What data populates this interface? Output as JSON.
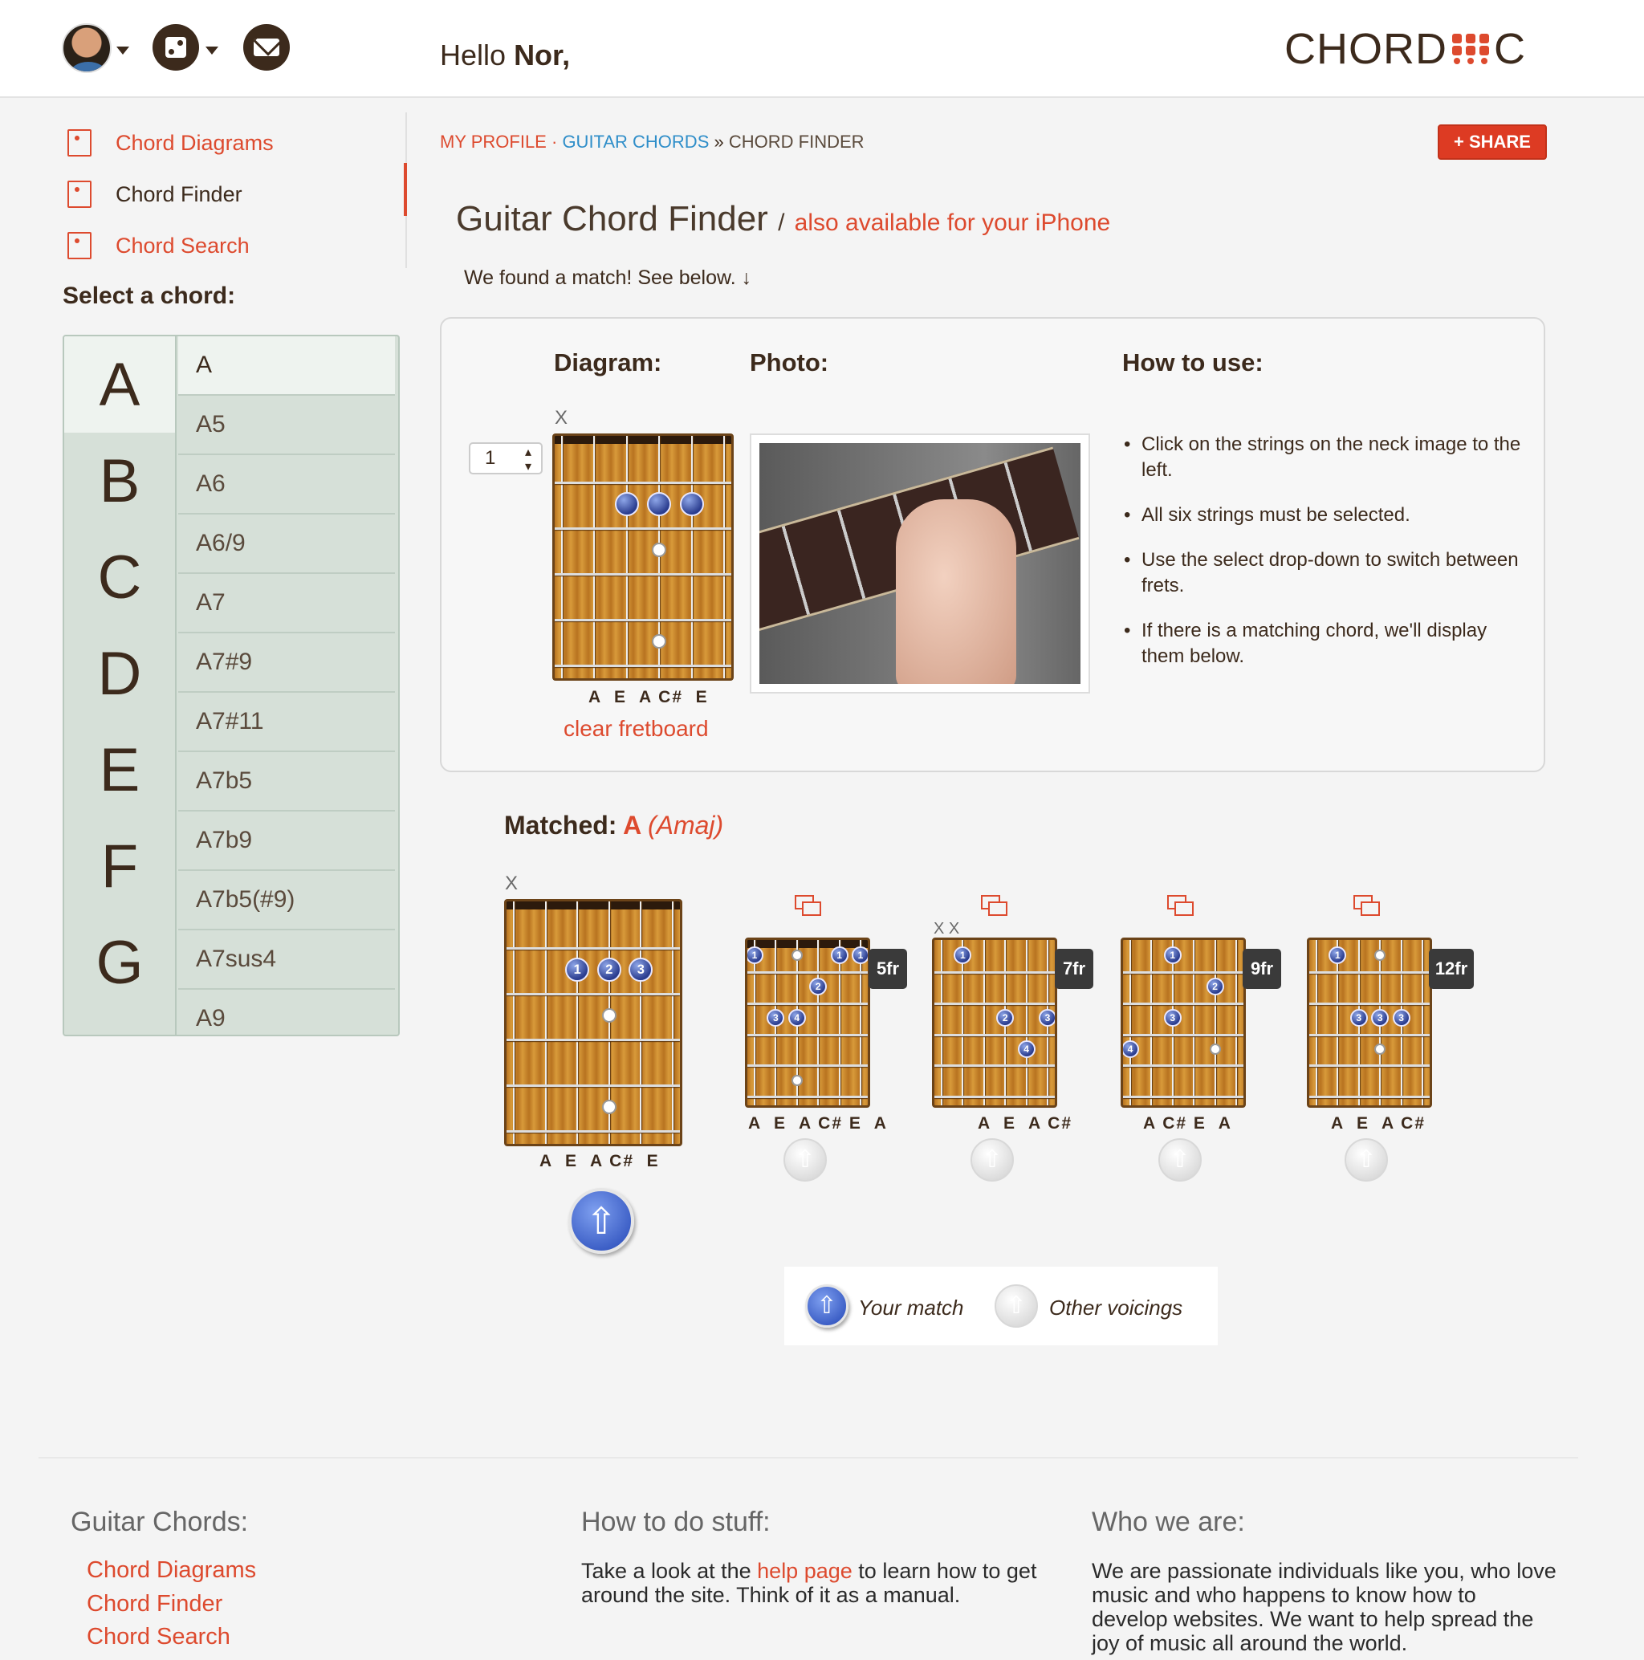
{
  "header": {
    "greeting": "Hello",
    "user": "Nor,",
    "logo_left": "CHORD",
    "logo_right": "C"
  },
  "sidenav": {
    "items": [
      {
        "label": "Chord Diagrams"
      },
      {
        "label": "Chord Finder"
      },
      {
        "label": "Chord Search"
      }
    ],
    "active": "Chord Finder"
  },
  "select_label": "Select a chord:",
  "letters": [
    "A",
    "B",
    "C",
    "D",
    "E",
    "F",
    "G"
  ],
  "chords": [
    "A",
    "A5",
    "A6",
    "A6/9",
    "A7",
    "A7#9",
    "A7#11",
    "A7b5",
    "A7b9",
    "A7b5(#9)",
    "A7sus4",
    "A9"
  ],
  "breadcrumb": {
    "profile": "MY PROFILE",
    "sep1": "·",
    "chords": "GUITAR CHORDS",
    "sep2": "»",
    "current": "CHORD FINDER"
  },
  "share_label": "+ SHARE",
  "title": "Guitar Chord Finder",
  "title_sep": "/",
  "title_sub": "also available for your iPhone",
  "found_text": "We found a match! See below. ↓",
  "panel": {
    "diagram_label": "Diagram:",
    "photo_label": "Photo:",
    "howto_label": "How to use:",
    "fret_value": "1",
    "muted": "X",
    "notes": "A  E  A C#  E",
    "clear_label": "clear fretboard",
    "howto": [
      "Click on the strings on the neck image to the left.",
      "All six strings must be selected.",
      "Use the select drop-down to switch between frets.",
      "If there is a matching chord, we'll display them below."
    ]
  },
  "matched": {
    "label": "Matched:",
    "chord": "A",
    "quality": "(Amaj)"
  },
  "voicings": [
    {
      "notes": "A  E  A C#  E",
      "fret": "",
      "main": true
    },
    {
      "notes": "A  E  A C# E  A",
      "fret": "5fr"
    },
    {
      "notes": "A  E  A C#",
      "fret": "7fr"
    },
    {
      "notes": "A C# E  A",
      "fret": "9fr"
    },
    {
      "notes": "A  E  A C#",
      "fret": "12fr"
    }
  ],
  "legend": {
    "your_match": "Your match",
    "other": "Other voicings"
  },
  "footer": {
    "col1_title": "Guitar Chords:",
    "col1_links": [
      "Chord Diagrams",
      "Chord Finder",
      "Chord Search"
    ],
    "col2_title": "How to do stuff:",
    "col2_pre": "Take a look at the",
    "col2_link": "help page",
    "col2_post": "to learn how to get around the site. Think of it as a manual.",
    "col3_title": "Who we are:",
    "col3_text": "We are passionate individuals like you, who love music and who happens to know how to develop websites. We want to help spread the joy of music all around the world."
  },
  "colors": {
    "accent": "#dd4a2e",
    "link_blue": "#2f8ec9",
    "list_bg": "#d6e0d8",
    "dot_blue": "#2b3d8f"
  }
}
